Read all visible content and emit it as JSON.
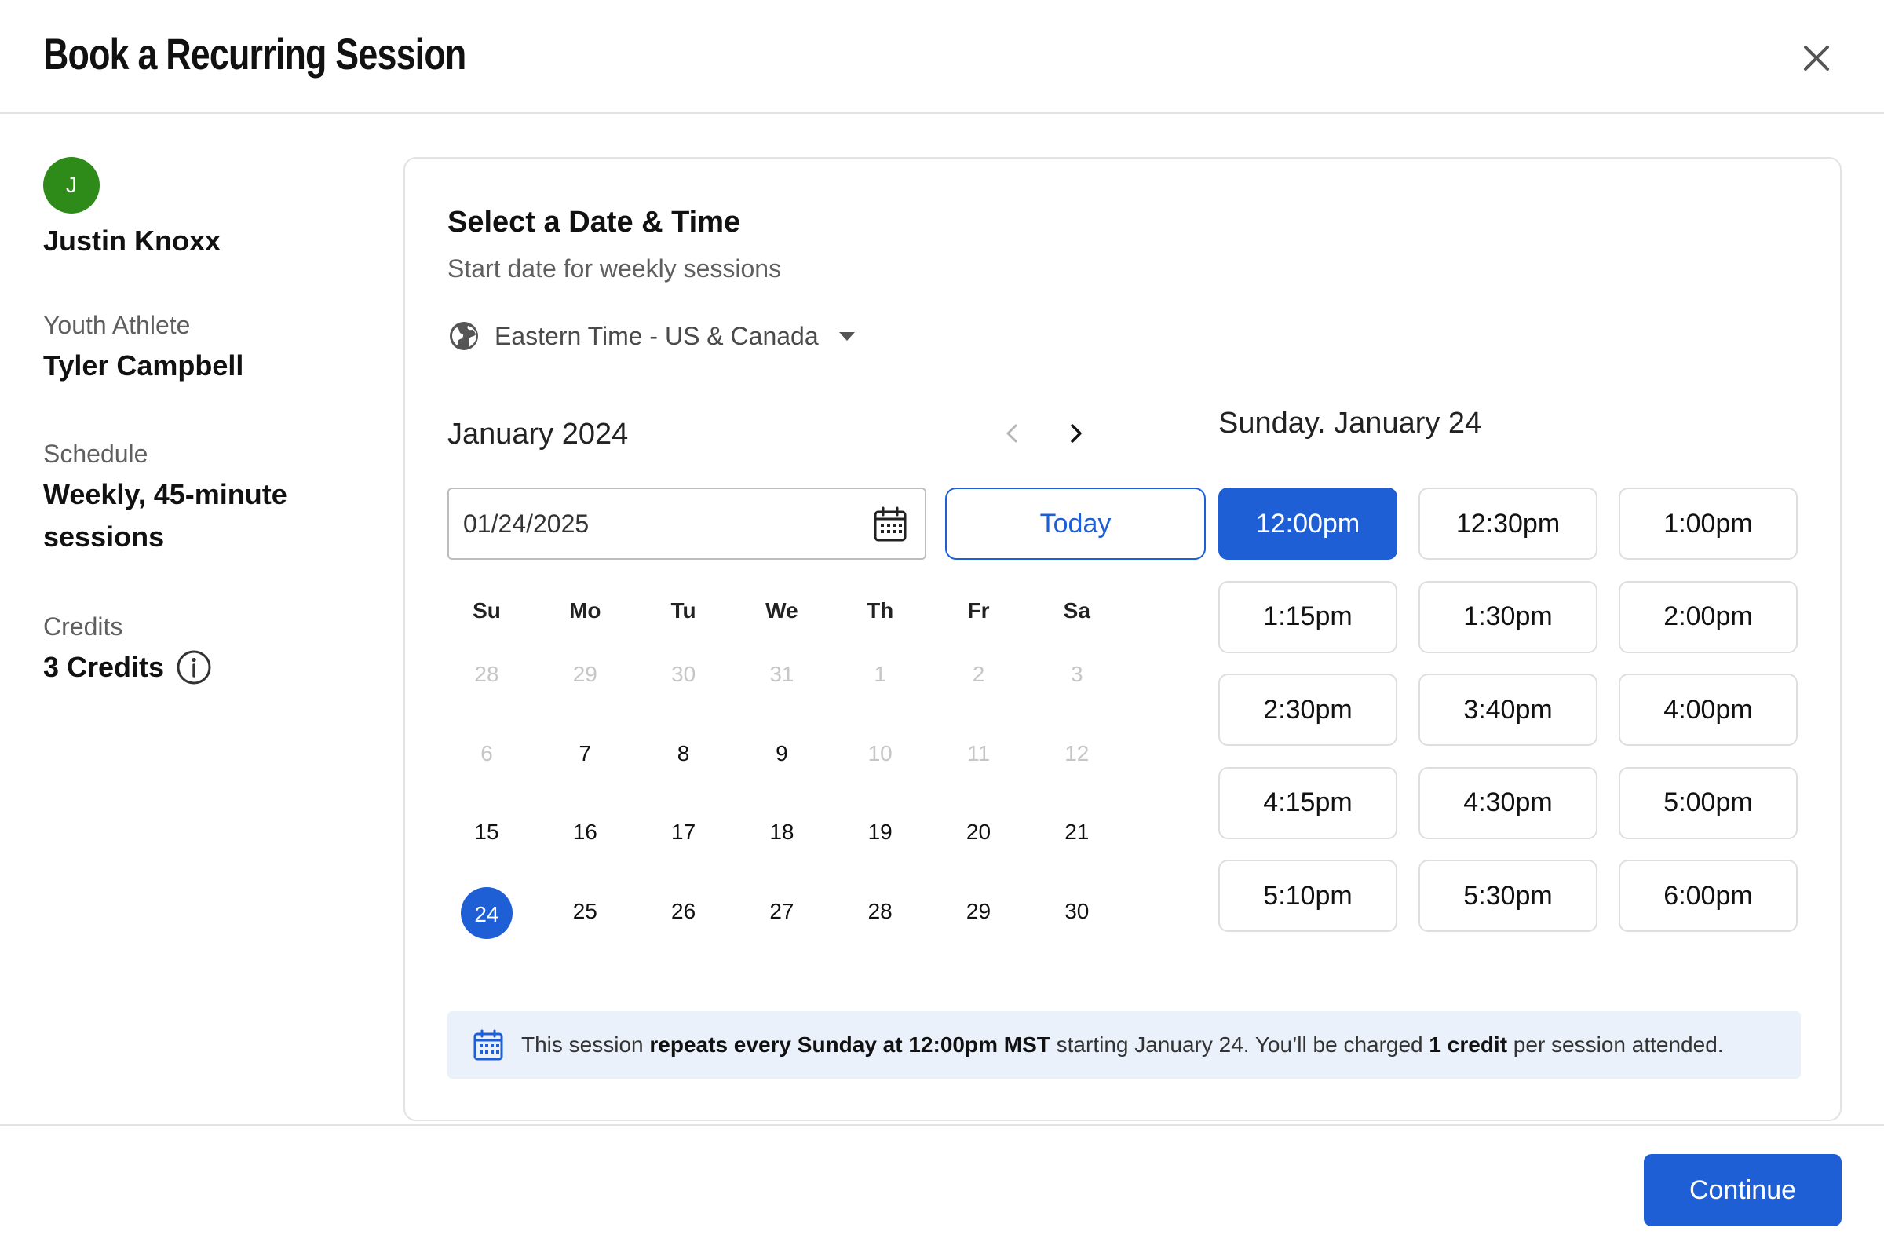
{
  "modal": {
    "title": "Book a Recurring Session"
  },
  "user": {
    "initial": "J",
    "name": "Justin Knoxx"
  },
  "details": {
    "athlete_label": "Youth Athlete",
    "athlete_value": "Tyler Campbell",
    "schedule_label": "Schedule",
    "schedule_value": "Weekly, 45-minute sessions",
    "credits_label": "Credits",
    "credits_value": "3 Credits"
  },
  "picker": {
    "title": "Select a Date & Time",
    "subtitle": "Start date for weekly sessions",
    "timezone": "Eastern Time - US & Canada",
    "month_label": "January 2024",
    "date_input_value": "01/24/2025",
    "today_label": "Today",
    "weekdays": [
      "Su",
      "Mo",
      "Tu",
      "We",
      "Th",
      "Fr",
      "Sa"
    ],
    "weeks": [
      [
        {
          "d": "28",
          "muted": true
        },
        {
          "d": "29",
          "muted": true
        },
        {
          "d": "30",
          "muted": true
        },
        {
          "d": "31",
          "muted": true
        },
        {
          "d": "1",
          "muted": true
        },
        {
          "d": "2",
          "muted": true
        },
        {
          "d": "3",
          "muted": true
        }
      ],
      [
        {
          "d": "6",
          "muted": true
        },
        {
          "d": "7"
        },
        {
          "d": "8"
        },
        {
          "d": "9"
        },
        {
          "d": "10",
          "muted": true
        },
        {
          "d": "11",
          "muted": true
        },
        {
          "d": "12",
          "muted": true
        }
      ],
      [
        {
          "d": "15"
        },
        {
          "d": "16"
        },
        {
          "d": "17"
        },
        {
          "d": "18"
        },
        {
          "d": "19"
        },
        {
          "d": "20"
        },
        {
          "d": "21"
        }
      ],
      [
        {
          "d": "24",
          "selected": true
        },
        {
          "d": "25"
        },
        {
          "d": "26"
        },
        {
          "d": "27"
        },
        {
          "d": "28"
        },
        {
          "d": "29"
        },
        {
          "d": "30"
        }
      ]
    ],
    "slot_date": "Sunday. January 24",
    "slots": [
      "12:00pm",
      "12:30pm",
      "1:00pm",
      "1:15pm",
      "1:30pm",
      "2:00pm",
      "2:30pm",
      "3:40pm",
      "4:00pm",
      "4:15pm",
      "4:30pm",
      "5:00pm",
      "5:10pm",
      "5:30pm",
      "6:00pm"
    ],
    "selected_slot": "12:00pm"
  },
  "banner": {
    "part1": "This session ",
    "bold1": "repeats every Sunday at 12:00pm MST",
    "part2": " starting January 24. You’ll be charged ",
    "bold2": "1 credit",
    "part3": " per session attended."
  },
  "footer": {
    "continue_label": "Continue"
  },
  "colors": {
    "accent": "#1e5fd6",
    "avatar": "#2e8b19",
    "banner_bg": "#eaf1fb"
  }
}
